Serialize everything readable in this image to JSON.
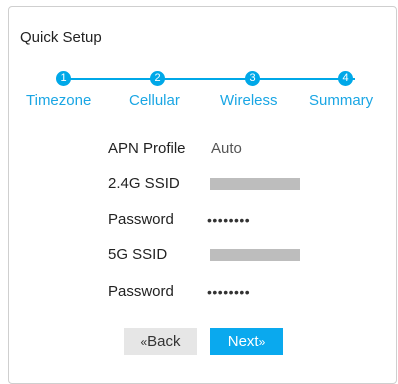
{
  "panel": {
    "title": "Quick Setup"
  },
  "steps": [
    {
      "number": "1",
      "label": "Timezone"
    },
    {
      "number": "2",
      "label": "Cellular"
    },
    {
      "number": "3",
      "label": "Wireless"
    },
    {
      "number": "4",
      "label": "Summary"
    }
  ],
  "form": {
    "apn_profile": {
      "label": "APN Profile",
      "value": "Auto"
    },
    "ssid_24": {
      "label": "2.4G SSID"
    },
    "password_24": {
      "label": "Password",
      "value": "••••••••"
    },
    "ssid_5": {
      "label": "5G SSID"
    },
    "password_5": {
      "label": "Password",
      "value": "••••••••"
    }
  },
  "buttons": {
    "back": {
      "chevron": "«",
      "label": "Back"
    },
    "next": {
      "label": "Next",
      "chevron": "»"
    }
  },
  "colors": {
    "accent": "#00a8e8",
    "next_bg": "#0aa9ee",
    "back_bg": "#e6e6e6",
    "redacted": "#bdbdbd"
  }
}
